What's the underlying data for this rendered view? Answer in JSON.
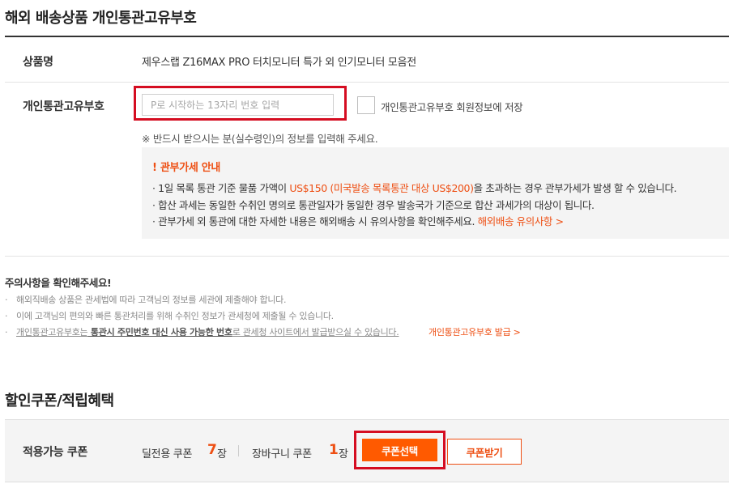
{
  "customs": {
    "section_title": "해외 배송상품 개인통관고유부호",
    "product_label": "상품명",
    "product_name": "제우스랩 Z16MAX PRO 터치모니터 특가 외 인기모니터 모음전",
    "pccc_label": "개인통관고유부호",
    "pccc_input_value": "",
    "pccc_placeholder": "P로 시작하는 13자리 번호 입력",
    "save_checkbox_checked": false,
    "save_label": "개인통관고유부호 회원정보에 저장",
    "note": "※ 반드시 받으시는 분(실수령인)의 정보를 입력해 주세요.",
    "tax_info": {
      "title": "! 관부가세 안내",
      "line1_pre": "· 1일 목록 통관 기준 물품 가액이 ",
      "line1_highlight": "US$150 (미국발송 목록통관 대상 US$200)",
      "line1_post": "을 초과하는 경우 관부가세가 발생 할 수 있습니다.",
      "line2": "· 합산 과세는 동일한 수취인 명의로 통관일자가 동일한 경우 발송국가 기준으로 합산 과세가의 대상이 됩니다.",
      "line3_pre": "· 관부가세 외 통관에 대한 자세한 내용은 해외배송 시 유의사항을 확인해주세요. ",
      "line3_link": "해외배송 유의사항 >"
    }
  },
  "caution": {
    "title": "주의사항을 확인해주세요!",
    "bullet": "·",
    "item1": "해외직배송 상품은 관세법에 따라 고객님의 정보를 세관에 제출해야 합니다.",
    "item2": "이에 고객님의 편의와 빠른 통관처리를 위해 수취인 정보가 관세청에 제출될 수 있습니다.",
    "item3_a": "개인통관고유부호는",
    "item3_b": " 통관시 주민번호 대신 사용 가능한 번호",
    "item3_c": "로 관세청 사이트에서 발급받으실 수 있습니다.",
    "issue_link": "개인통관고유부호 발급 >"
  },
  "coupon": {
    "section_title": "할인쿠폰/적립혜택",
    "available_label": "적용가능 쿠폰",
    "deal_coupon_label": "딜전용 쿠폰",
    "deal_coupon_count": "7",
    "cart_coupon_label": "장바구니 쿠폰",
    "cart_coupon_count": "1",
    "unit": "장",
    "select_button": "쿠폰선택",
    "receive_button": "쿠폰받기"
  },
  "colors": {
    "accent": "#ee4f13",
    "button_fill": "#ff5a00",
    "highlight_border": "#d50d21"
  }
}
